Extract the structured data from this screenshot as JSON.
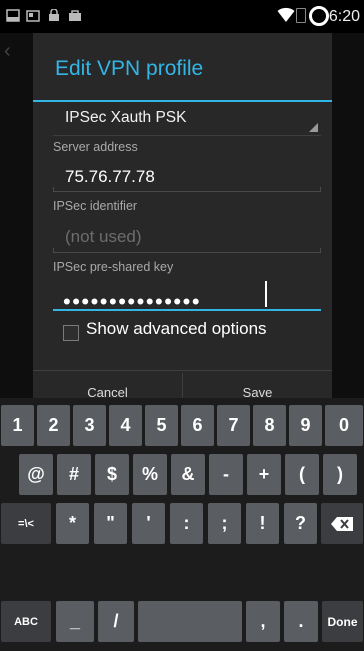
{
  "status_bar": {
    "time": "6:20",
    "icons": [
      "screenshot-icon",
      "photo-icon",
      "bag-icon",
      "shop-icon",
      "wifi-icon",
      "battery-icon",
      "sync-circle-icon"
    ]
  },
  "dialog": {
    "title": "Edit VPN profile",
    "vpn_type": "IPSec Xauth PSK",
    "server_address": {
      "label": "Server address",
      "value": "75.76.77.78"
    },
    "ipsec_identifier": {
      "label": "IPSec identifier",
      "placeholder": "(not used)"
    },
    "psk": {
      "label": "IPSec pre-shared key",
      "masked_value": "•••••••••••••••"
    },
    "show_advanced": {
      "label": "Show advanced options",
      "checked": false
    },
    "buttons": {
      "cancel": "Cancel",
      "save": "Save"
    }
  },
  "keyboard": {
    "row1": [
      "1",
      "2",
      "3",
      "4",
      "5",
      "6",
      "7",
      "8",
      "9",
      "0"
    ],
    "row2": [
      "@",
      "#",
      "$",
      "%",
      "&",
      "-",
      "+",
      "(",
      ")"
    ],
    "row3": {
      "symbols_switch": "=\\<",
      "keys": [
        "*",
        "\"",
        "'",
        ":",
        ";",
        "!",
        "?"
      ]
    },
    "row4": {
      "abc": "ABC",
      "underscore": "_",
      "slash": "/",
      "comma": ",",
      "period": ".",
      "done": "Done"
    }
  }
}
